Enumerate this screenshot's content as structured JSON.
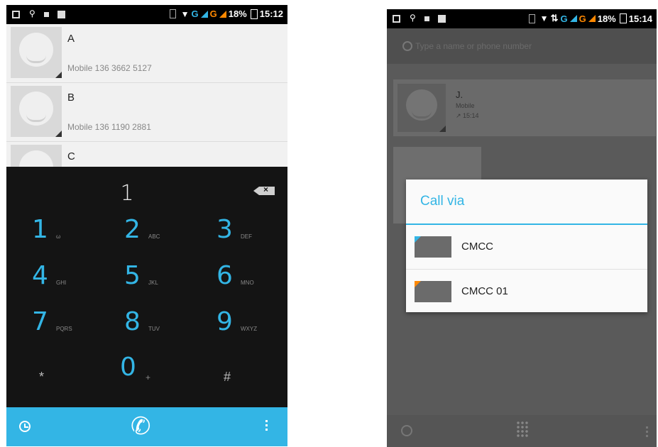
{
  "left_phone": {
    "status": {
      "battery": "18%",
      "time": "15:12",
      "network_1": "G",
      "network_2": "G"
    },
    "contacts": [
      {
        "name": "A",
        "phone_label": "Mobile 136 3662 5127"
      },
      {
        "name": "B",
        "phone_label": "Mobile 136 1190 2881"
      },
      {
        "name": "C"
      }
    ],
    "dialer": {
      "digits": "1",
      "keys": [
        {
          "num": "1",
          "letters": "ω"
        },
        {
          "num": "2",
          "letters": "ABC"
        },
        {
          "num": "3",
          "letters": "DEF"
        },
        {
          "num": "4",
          "letters": "GHI"
        },
        {
          "num": "5",
          "letters": "JKL"
        },
        {
          "num": "6",
          "letters": "MNO"
        },
        {
          "num": "7",
          "letters": "PQRS"
        },
        {
          "num": "8",
          "letters": "TUV"
        },
        {
          "num": "9",
          "letters": "WXYZ"
        },
        {
          "num": "*",
          "letters": ""
        },
        {
          "num": "0",
          "letters": "+"
        },
        {
          "num": "#",
          "letters": ""
        }
      ]
    },
    "accent_color": "#33b5e5"
  },
  "right_phone": {
    "status": {
      "battery": "18%",
      "time": "15:14",
      "network_1": "G",
      "network_2": "G"
    },
    "search_placeholder": "Type a name or phone number",
    "recent": {
      "name": "J.",
      "type": "Mobile",
      "time": "↗ 15:14"
    },
    "dialog": {
      "title": "Call via",
      "options": [
        "CMCC",
        "CMCC 01"
      ]
    }
  }
}
